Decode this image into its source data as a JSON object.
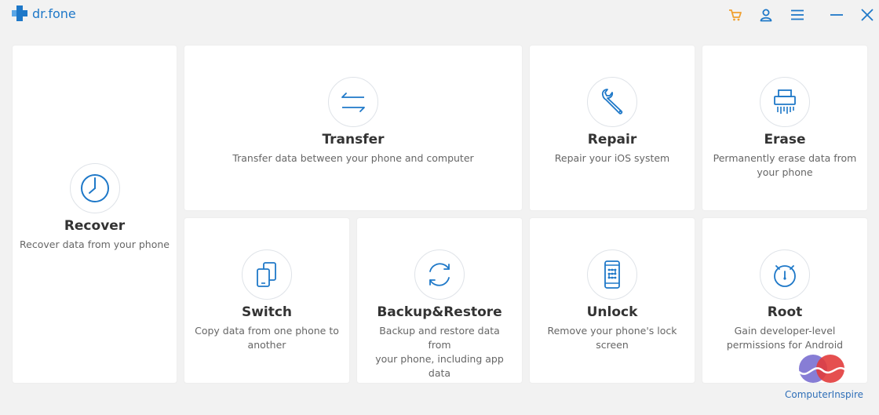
{
  "app": {
    "name": "dr.fone"
  },
  "colors": {
    "accent": "#1e78c8",
    "cart": "#f0a030",
    "background": "#f2f2f2",
    "card": "#ffffff"
  },
  "titlebar": {
    "icons": [
      "cart-icon",
      "user-icon",
      "menu-icon",
      "minimize-icon",
      "close-icon"
    ]
  },
  "modules": {
    "recover": {
      "title": "Recover",
      "desc": "Recover data from your phone",
      "icon": "clock-icon"
    },
    "transfer": {
      "title": "Transfer",
      "desc": "Transfer data between your phone and computer",
      "icon": "arrows-exchange-icon"
    },
    "repair": {
      "title": "Repair",
      "desc": "Repair your iOS system",
      "icon": "wrench-icon"
    },
    "erase": {
      "title": "Erase",
      "desc_line1": "Permanently erase data from",
      "desc_line2": "your phone",
      "icon": "shredder-icon"
    },
    "switch": {
      "title": "Switch",
      "desc_line1": "Copy data from one phone to",
      "desc_line2": "another",
      "icon": "phone-switch-icon"
    },
    "backup": {
      "title": "Backup&Restore",
      "desc_line1": "Backup and restore data from",
      "desc_line2": "your phone, including app data",
      "icon": "sync-icon"
    },
    "unlock": {
      "title": "Unlock",
      "desc_line1": "Remove your phone's lock",
      "desc_line2": "screen",
      "icon": "phone-pattern-icon"
    },
    "root": {
      "title": "Root",
      "desc_line1": "Gain developer-level",
      "desc_line2": "permissions for Android",
      "icon": "android-timer-icon"
    }
  },
  "watermark": {
    "text": "ComputerInspire"
  }
}
